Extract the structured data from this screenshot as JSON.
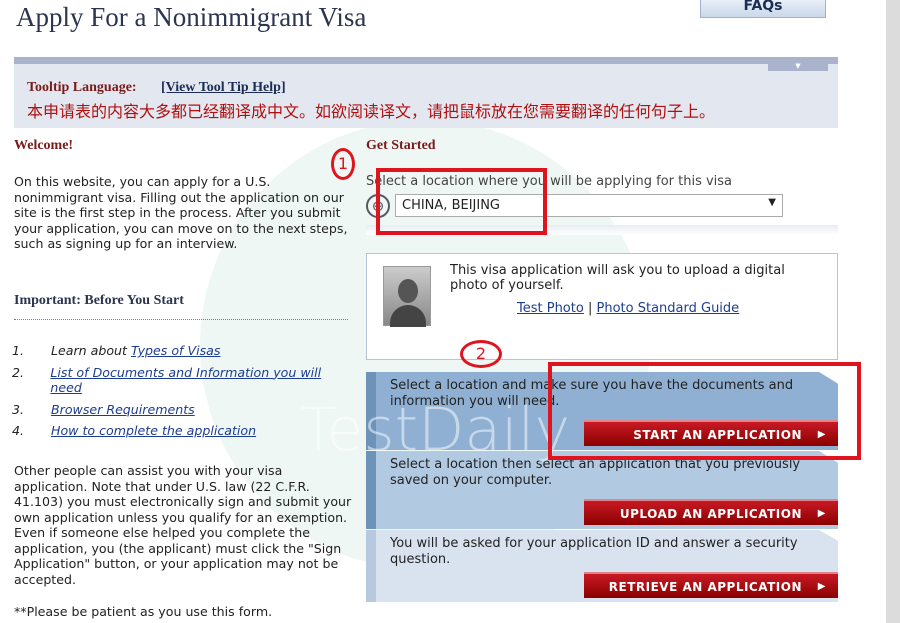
{
  "header": {
    "title": "Apply For a Nonimmigrant Visa",
    "faqs_label": "FAQs"
  },
  "tooltip": {
    "label": "Tooltip Language:",
    "help_link": "[View Tool Tip Help]",
    "chinese_notice": "本申请表的内容大多都已经翻译成中文。如欲阅读译文，请把鼠标放在您需要翻译的任何句子上。"
  },
  "left": {
    "welcome_heading": "Welcome!",
    "welcome_text": "On this website, you can apply for a U.S. nonimmigrant visa. Filling out the application on our site is the first step in the process. After you submit your application, you can move on to the next steps, such as signing up for an interview.",
    "important_heading": "Important: Before You Start",
    "items": [
      {
        "num": "1.",
        "prefix": "Learn about ",
        "link": "Types of Visas"
      },
      {
        "num": "2.",
        "prefix": "",
        "link": "List of Documents and Information you will need"
      },
      {
        "num": "3.",
        "prefix": "",
        "link": "Browser Requirements"
      },
      {
        "num": "4.",
        "prefix": "",
        "link": "How to complete the application"
      }
    ],
    "other_text": "Other people can assist you with your visa application. Note that under U.S. law (22 C.F.R. 41.103) you must electronically sign and submit your own application unless you qualify for an exemption. Even if someone else helped you complete the application, you (the applicant) must click the \"Sign Application\" button, or your application may not be accepted.",
    "patient_text": "**Please be patient as you use this form."
  },
  "get_started": {
    "heading": "Get Started",
    "location_label": "Select a location where you will be applying for this visa",
    "location_value": "CHINA, BEIJING",
    "photo_text": "This visa application will ask you to upload a digital photo of yourself.",
    "test_photo": "Test Photo",
    "separator": "|",
    "photo_guide": "Photo Standard Guide",
    "panels": [
      {
        "text": "Select a location and make sure you have the documents and information you will need.",
        "button": "START AN APPLICATION",
        "color": "#8fb0d3"
      },
      {
        "text": "Select a location then select an application that you previously saved on your computer.",
        "button": "UPLOAD AN APPLICATION",
        "color": "#b2c9e2"
      },
      {
        "text": "You will be asked for your application ID and answer a security question.",
        "button": "RETRIEVE AN APPLICATION",
        "color": "#d9e3ef"
      }
    ]
  },
  "annotations": {
    "one": "1",
    "two": "2",
    "color": "#e0141e"
  },
  "watermark": "TestDaily"
}
